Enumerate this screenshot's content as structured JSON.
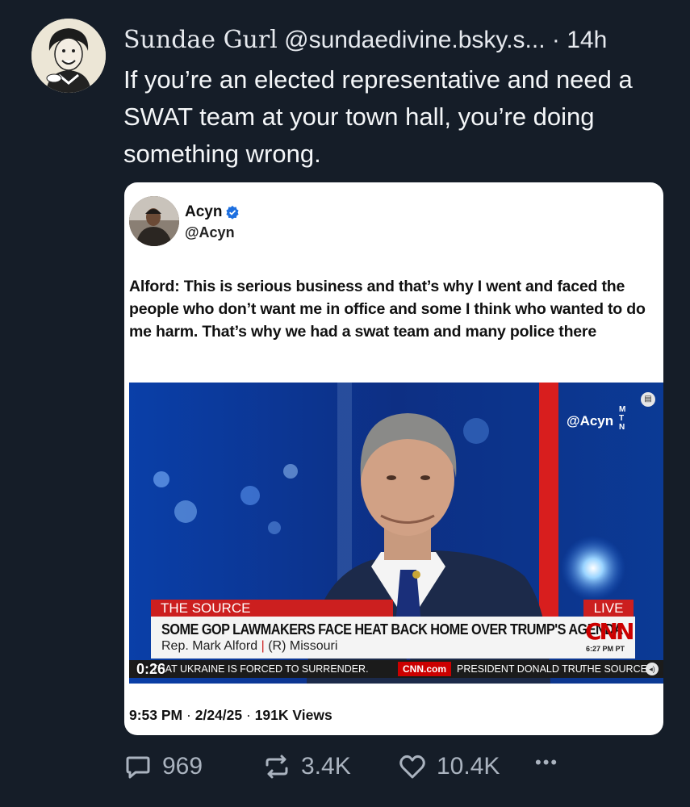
{
  "post": {
    "author_name": "Sundae Gurl",
    "author_handle": "@sundaedivine.bsky.s...",
    "time": "· 14h",
    "text": "If you’re an elected representative and need a SWAT team at your town hall, you’re doing something wrong."
  },
  "embed": {
    "author_name": "Acyn",
    "author_handle": "@Acyn",
    "text": "Alford: This is serious business and that’s why I went and faced the people who don’t want me in office and some I think who wanted to do me harm. That’s why we had a swat team and many police there",
    "time": "9:53 PM",
    "date": "2/24/25",
    "views_count": "191K",
    "views_label": "Views",
    "video": {
      "watermark": "@Acyn",
      "mtn": "M T N",
      "show_label": "THE SOURCE",
      "live_label": "LIVE",
      "headline": "SOME GOP LAWMAKERS FACE HEAT BACK HOME OVER TRUMP'S AGENDA",
      "guest_name": "Rep. Mark Alford",
      "guest_party": "(R) Missouri",
      "network": "CNN",
      "clock": "6:27 PM PT",
      "elapsed": "0:26",
      "ticker_1": "THAT UKRAINE IS FORCED TO SURRENDER.",
      "ticker_site": "CNN.com",
      "ticker_2": "PRESIDENT DONALD TRU",
      "ticker_show": "THE SOURCE"
    }
  },
  "actions": {
    "replies": "969",
    "reposts": "3.4K",
    "likes": "10.4K",
    "more": "•••"
  },
  "colors": {
    "background": "#151d28",
    "text": "#f4f6f8",
    "muted": "#aab3bf",
    "verified": "#1d6fe0",
    "cnn_red": "#cc0000"
  }
}
